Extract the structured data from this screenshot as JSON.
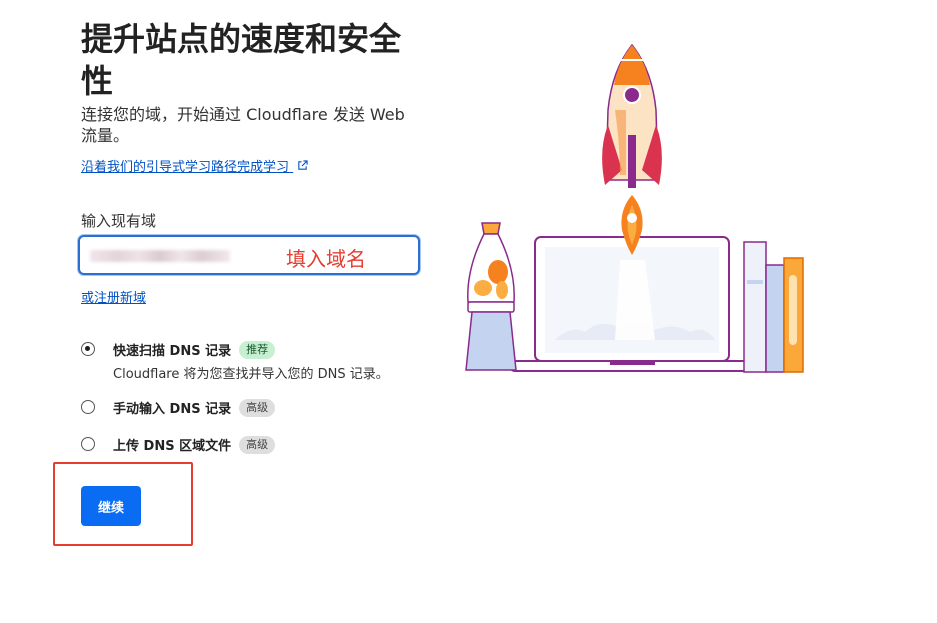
{
  "header": {
    "title": "提升站点的速度和安全性",
    "subtitle": "连接您的域，开始通过 Cloudflare 发送 Web 流量。",
    "learn_link": "沿着我们的引导式学习路径完成学习"
  },
  "domain": {
    "label": "输入现有域",
    "value": "",
    "annotation": "填入域名",
    "register_link": "或注册新域"
  },
  "options": [
    {
      "title": "快速扫描 DNS 记录",
      "badge": "推荐",
      "description": "Cloudflare 将为您查找并导入您的 DNS 记录。",
      "selected": true
    },
    {
      "title": "手动输入 DNS 记录",
      "badge": "高级",
      "selected": false
    },
    {
      "title": "上传 DNS 区域文件",
      "badge": "高级",
      "selected": false
    }
  ],
  "actions": {
    "continue_label": "继续"
  },
  "colors": {
    "accent": "#0a6cf2",
    "link": "#0051c3",
    "annotation": "#e53d2f"
  },
  "icons": {
    "external_link": "external-link-icon"
  }
}
